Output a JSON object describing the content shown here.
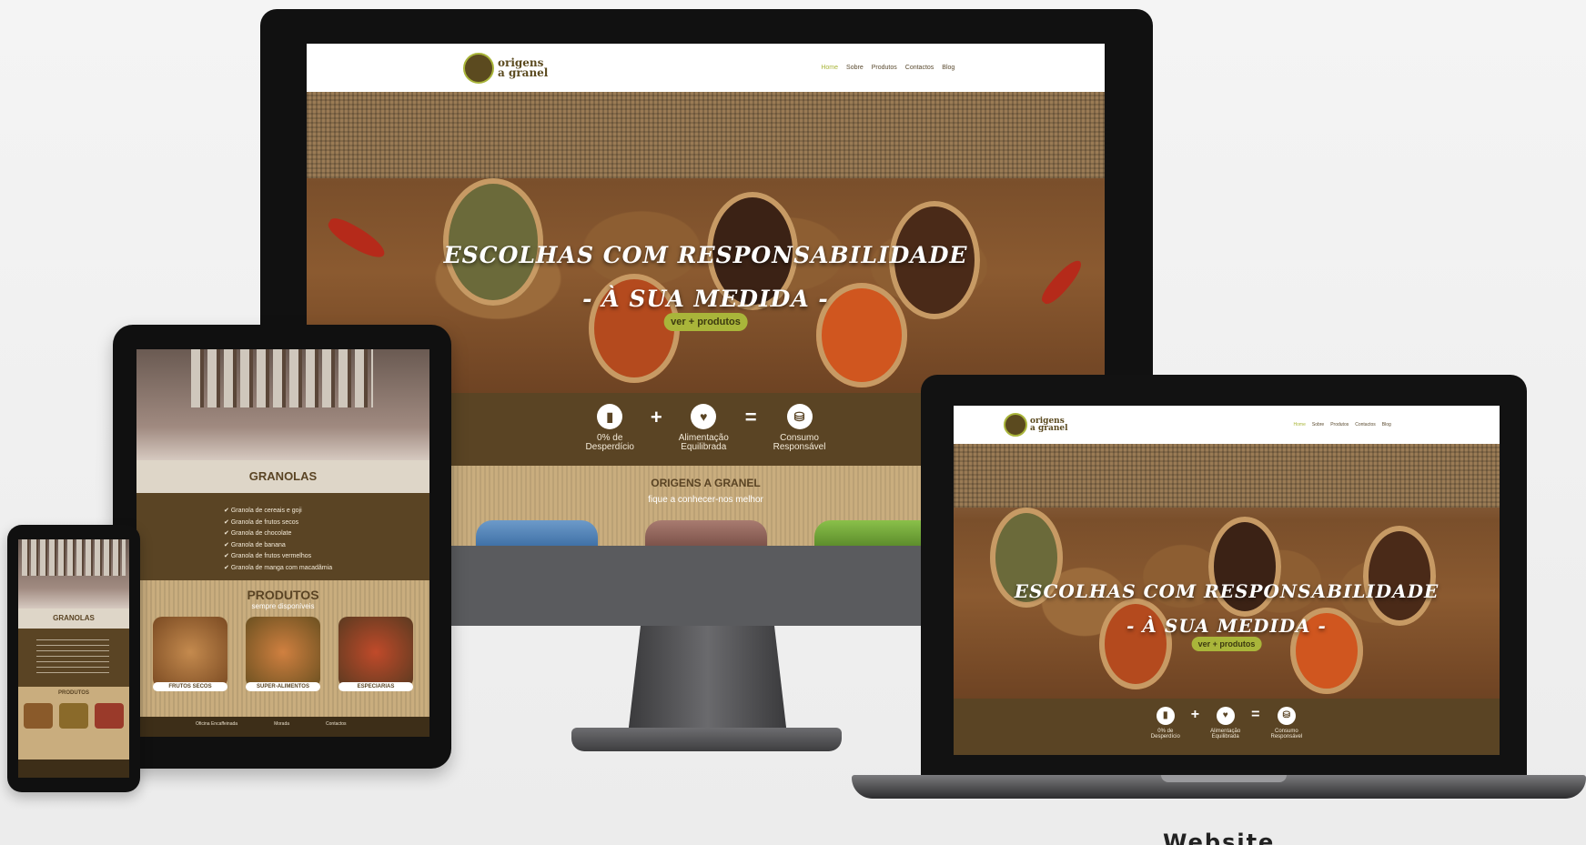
{
  "site": {
    "brand_line1": "origens",
    "brand_line2": "a granel",
    "menu": [
      "Home",
      "Sobre",
      "Produtos",
      "Contactos",
      "Blog"
    ],
    "hero_line1": "ESCOLHAS COM RESPONSABILIDADE",
    "hero_line2": "- À SUA MEDIDA -",
    "hero_button": "ver + produtos",
    "features": [
      {
        "line1": "0% de",
        "line2": "Desperdício"
      },
      {
        "line1": "Alimentação",
        "line2": "Equilibrada"
      },
      {
        "line1": "Consumo",
        "line2": "Responsável"
      }
    ],
    "plus": "+",
    "equals": "=",
    "about_title": "ORIGENS A GRANEL",
    "about_subtitle": "fique a conhecer-nos melhor"
  },
  "tablet": {
    "section_title": "GRANOLAS",
    "granolas": [
      "Granola de cereais e goji",
      "Granola de frutos secos",
      "Granola de chocolate",
      "Granola de banana",
      "Granola de frutos vermelhos",
      "Granola de manga com macadâmia"
    ],
    "products_title": "PRODUTOS",
    "products_subtitle": "sempre disponíveis",
    "products": [
      "FRUTOS SECOS",
      "SUPER-ALIMENTOS",
      "ESPECIARIAS"
    ],
    "footer_cols": [
      "Oficina Encaffeinada",
      "Morada",
      "Contactos"
    ]
  },
  "phone": {
    "section_title": "GRANOLAS",
    "products_title": "PRODUTOS"
  },
  "caption": "Website",
  "colors": {
    "brown": "#5a4424",
    "accent": "#a9b53a",
    "burlap": "#c9ad7e"
  }
}
